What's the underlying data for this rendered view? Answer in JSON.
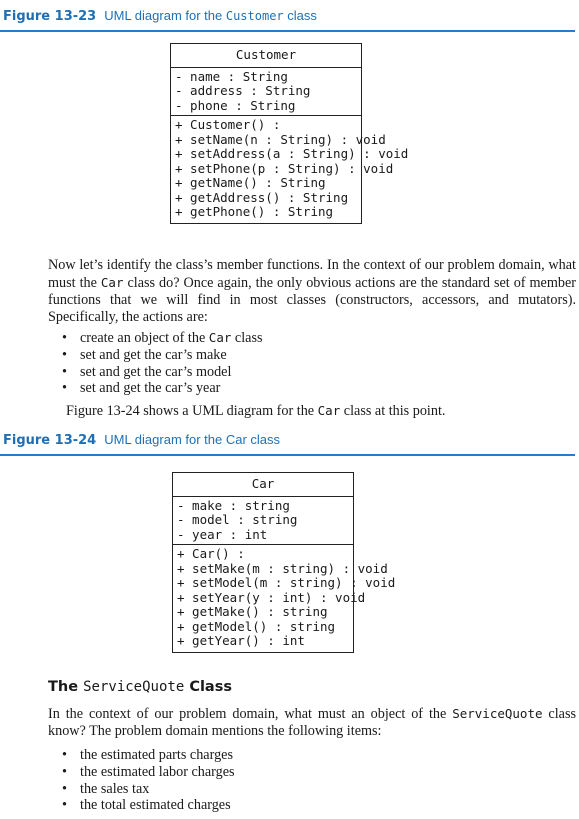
{
  "figure_23": {
    "number": "Figure 13-23",
    "caption_prefix": "UML diagram for the ",
    "caption_code": "Customer",
    "caption_suffix": " class",
    "uml": {
      "class_name": "Customer",
      "attributes": [
        "- name : String",
        "- address : String",
        "- phone : String"
      ],
      "operations": [
        "+ Customer() :",
        "+ setName(n : String) : void",
        "+ setAddress(a : String) : void",
        "+ setPhone(p : String) : void",
        "+ getName() : String",
        "+ getAddress() : String",
        "+ getPhone() : String"
      ]
    }
  },
  "paragraph_1": {
    "part1": "Now let’s identify the class’s member functions. In the context of our problem domain, what must the ",
    "code": "Car",
    "part2": " class do? Once again, the only obvious actions are the standard set of member functions that we will find in most classes (constructors, accessors, and mutators). Specifically, the actions are:"
  },
  "actions_list": [
    {
      "pre": "create an object of the ",
      "code": "Car",
      "post": " class"
    },
    {
      "pre": "set and get the car’s make",
      "code": "",
      "post": ""
    },
    {
      "pre": "set and get the car’s model",
      "code": "",
      "post": ""
    },
    {
      "pre": "set and get the car’s year",
      "code": "",
      "post": ""
    }
  ],
  "paragraph_2": {
    "part1": "Figure 13-24 shows a UML diagram for the ",
    "code": "Car",
    "part2": " class at this point."
  },
  "figure_24": {
    "number": "Figure 13-24",
    "caption_prefix": "UML diagram for the Car class",
    "uml": {
      "class_name": "Car",
      "attributes": [
        "- make : string",
        "- model : string",
        "- year : int"
      ],
      "operations": [
        "+ Car() :",
        "+ setMake(m : string) : void",
        "+ setModel(m : string) : void",
        "+ setYear(y : int) : void",
        "+ getMake() : string",
        "+ getModel() : string",
        "+ getYear() : int"
      ]
    }
  },
  "section": {
    "heading_pre": "The ",
    "heading_code": "ServiceQuote",
    "heading_post": " Class",
    "para_part1": "In the context of our problem domain, what must an object of the ",
    "para_code": "ServiceQuote",
    "para_part2": " class know? The problem domain mentions the following items:",
    "items": [
      "the estimated parts charges",
      "the estimated labor charges",
      "the sales tax",
      "the total estimated charges"
    ]
  },
  "colors": {
    "figure_accent": "#1f6fb5",
    "rule": "#2a7ac7"
  }
}
